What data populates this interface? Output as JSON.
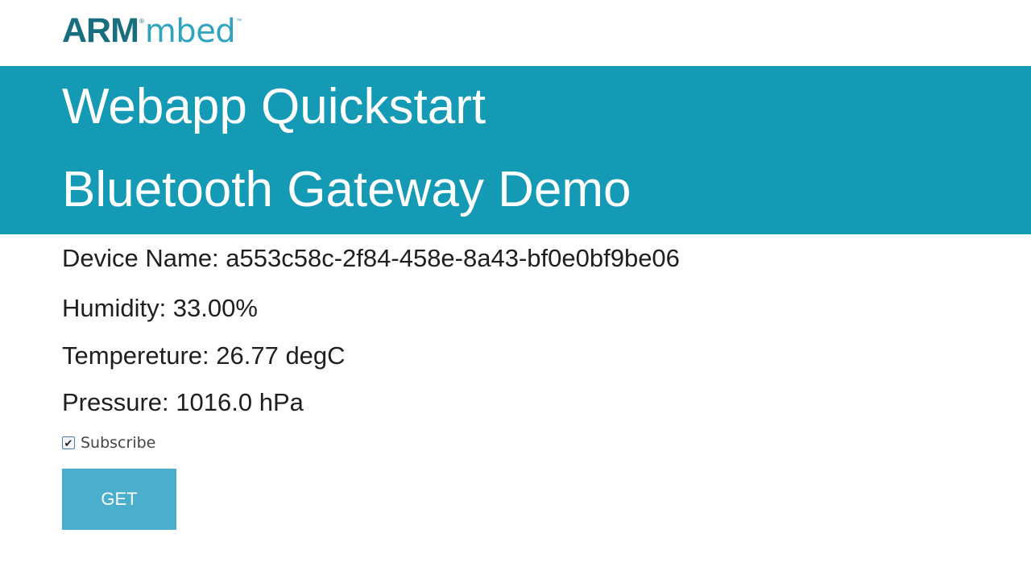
{
  "logo": {
    "arm": "ARM",
    "registered": "®",
    "mbed": "mbed",
    "trademark": "™"
  },
  "banner": {
    "title": "Webapp Quickstart",
    "subtitle": "Bluetooth Gateway Demo"
  },
  "device": {
    "name_label": "Device Name: a553c58c-2f84-458e-8a43-bf0e0bf9be06",
    "humidity_label": "Humidity: 33.00%",
    "temperature_label": "Tempereture: 26.77 degC",
    "pressure_label": "Pressure: 1016.0 hPa"
  },
  "subscribe": {
    "label": "Subscribe",
    "checked": true
  },
  "actions": {
    "get_label": "GET"
  },
  "colors": {
    "banner": "#159ab6",
    "button": "#4aaecc",
    "logo_arm": "#186d7f",
    "logo_mbed": "#2fa3bf"
  }
}
